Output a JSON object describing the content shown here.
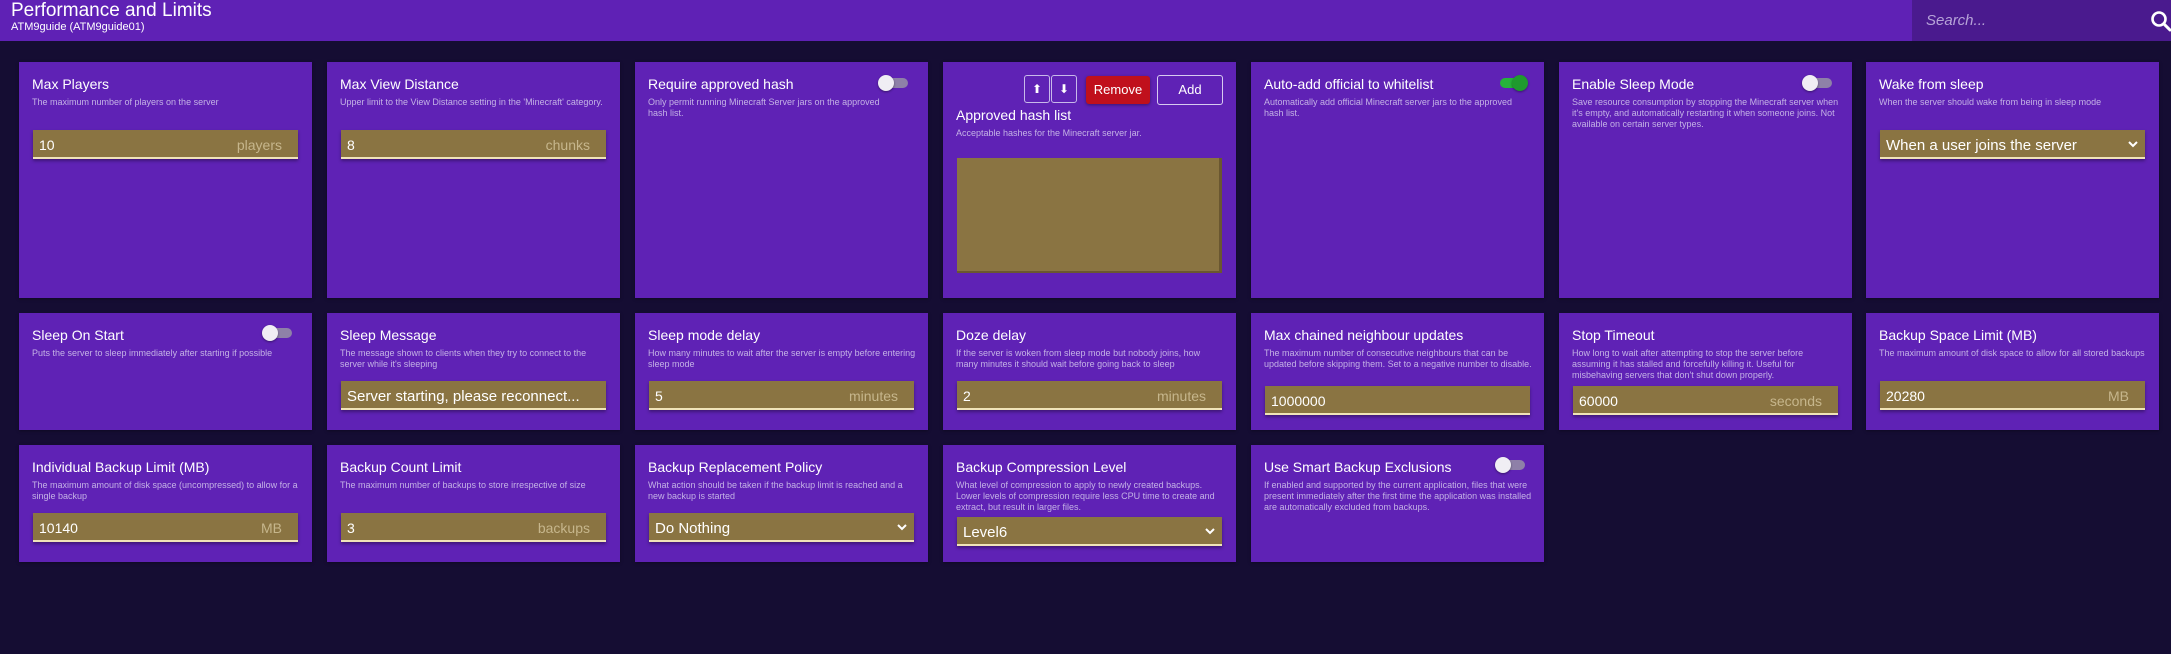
{
  "header": {
    "title": "Performance and Limits",
    "subtitle": "ATM9guide (ATM9guide01)",
    "search_placeholder": "Search..."
  },
  "cards": {
    "max_players": {
      "title": "Max Players",
      "desc": "The maximum number of players on the server",
      "value": "10",
      "unit": "players"
    },
    "max_view_distance": {
      "title": "Max View Distance",
      "desc": "Upper limit to the View Distance setting in the 'Minecraft' category.",
      "value": "8",
      "unit": "chunks"
    },
    "require_approved_hash": {
      "title": "Require approved hash",
      "desc": "Only permit running Minecraft Server jars on the approved hash list.",
      "enabled": false
    },
    "approved_hash_list": {
      "title": "Approved hash list",
      "desc": "Acceptable hashes for the Minecraft server jar.",
      "up_label": "⬆",
      "down_label": "⬇",
      "remove_label": "Remove",
      "add_label": "Add"
    },
    "auto_add_official": {
      "title": "Auto-add official to whitelist",
      "desc": "Automatically add official Minecraft server jars to the approved hash list.",
      "enabled": true
    },
    "enable_sleep_mode": {
      "title": "Enable Sleep Mode",
      "desc": "Save resource consumption by stopping the Minecraft server when it's empty, and automatically restarting it when someone joins. Not available on certain server types.",
      "enabled": false
    },
    "wake_from_sleep": {
      "title": "Wake from sleep",
      "desc": "When the server should wake from being in sleep mode",
      "value": "When a user joins the server"
    },
    "sleep_on_start": {
      "title": "Sleep On Start",
      "desc": "Puts the server to sleep immediately after starting if possible",
      "enabled": false
    },
    "sleep_message": {
      "title": "Sleep Message",
      "desc": "The message shown to clients when they try to connect to the server while it's sleeping",
      "value": "Server starting, please reconnect..."
    },
    "sleep_mode_delay": {
      "title": "Sleep mode delay",
      "desc": "How many minutes to wait after the server is empty before entering sleep mode",
      "value": "5",
      "unit": "minutes"
    },
    "doze_delay": {
      "title": "Doze delay",
      "desc": "If the server is woken from sleep mode but nobody joins, how many minutes it should wait before going back to sleep",
      "value": "2",
      "unit": "minutes"
    },
    "max_chained_neighbour_updates": {
      "title": "Max chained neighbour updates",
      "desc": "The maximum number of consecutive neighbours that can be updated before skipping them. Set to a negative number to disable.",
      "value": "1000000"
    },
    "stop_timeout": {
      "title": "Stop Timeout",
      "desc": "How long to wait after attempting to stop the server before assuming it has stalled and forcefully killing it. Useful for misbehaving servers that don't shut down properly.",
      "value": "60000",
      "unit": "seconds"
    },
    "backup_space_limit": {
      "title": "Backup Space Limit (MB)",
      "desc": "The maximum amount of disk space to allow for all stored backups",
      "value": "20280",
      "unit": "MB"
    },
    "individual_backup_limit": {
      "title": "Individual Backup Limit (MB)",
      "desc": "The maximum amount of disk space (uncompressed) to allow for a single backup",
      "value": "10140",
      "unit": "MB"
    },
    "backup_count_limit": {
      "title": "Backup Count Limit",
      "desc": "The maximum number of backups to store irrespective of size",
      "value": "3",
      "unit": "backups"
    },
    "backup_replacement_policy": {
      "title": "Backup Replacement Policy",
      "desc": "What action should be taken if the backup limit is reached and a new backup is started",
      "value": "Do Nothing"
    },
    "backup_compression_level": {
      "title": "Backup Compression Level",
      "desc": "What level of compression to apply to newly created backups. Lower levels of compression require less CPU time to create and extract, but result in larger files.",
      "value": "Level6"
    },
    "smart_backup_exclusions": {
      "title": "Use Smart Backup Exclusions",
      "desc": "If enabled and supported by the current application, files that were present immediately after the first time the application was installed are automatically excluded from backups.",
      "enabled": false
    }
  }
}
